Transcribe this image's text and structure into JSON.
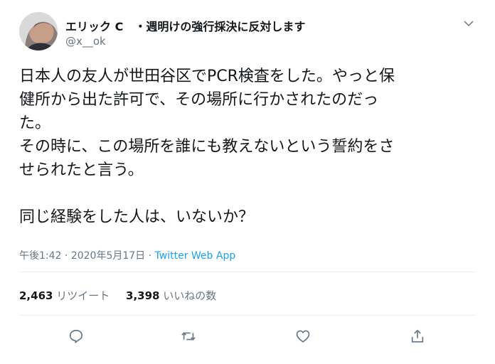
{
  "tweet": {
    "author_name": "エリック C　・週明けの強行採決に反対します",
    "author_handle": "@x__ok",
    "text": "日本人の友人が世田谷区でPCR検査をした。やっと保\n健所から出た許可で、その場所に行かされたのだっ\nた。\nその時に、この場所を誰にも教えないという誓約をさ\nせられたと言う。\n\n同じ経験をした人は、いないか？",
    "time": "午後1:42",
    "date": "2020年5月17日",
    "source": "Twitter Web App",
    "retweet_count": "2,463",
    "retweet_label": "リツイート",
    "like_count": "3,398",
    "like_label": "いいねの数"
  },
  "icons": {
    "caret": "chevron-down-icon",
    "reply": "reply-icon",
    "retweet": "retweet-icon",
    "like": "heart-icon",
    "share": "share-icon"
  },
  "colors": {
    "link": "#1da1f2",
    "secondary_text": "#657786",
    "divider": "#e6ecf0"
  }
}
